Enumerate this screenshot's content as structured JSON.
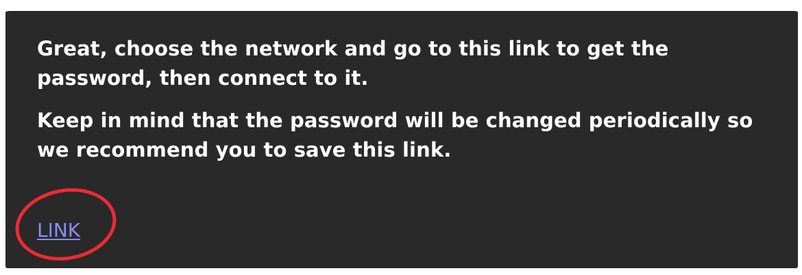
{
  "message": {
    "paragraphs": [
      "Great, choose the network and go to this link to get the password, then connect to it.",
      "Keep in mind that the password will be changed periodically so we recommend you to save this link."
    ],
    "link_label": "LINK"
  },
  "colors": {
    "card_background": "#292929",
    "text": "#ffffff",
    "link": "#8c8cff",
    "annotation": "#ef2a33"
  },
  "icons": {
    "annotation_shape": "red-oval-highlight"
  }
}
